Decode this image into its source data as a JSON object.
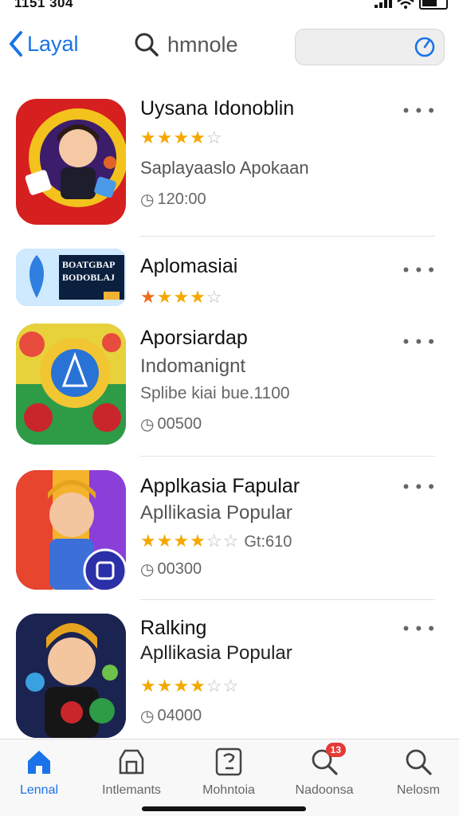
{
  "status": {
    "time": "1151 304"
  },
  "header": {
    "back_label": "Layal",
    "search_label": "hmnole"
  },
  "apps": [
    {
      "title": "Uysana Idonoblin",
      "rating": 4,
      "subtitle": "Saplayaaslo Apokaan",
      "meta": "120:00"
    },
    {
      "title": "Aplomasiai",
      "rating": 4,
      "banner_text": "BOATGBAP BODOBLAJ"
    },
    {
      "title": "Aporsiardap",
      "subtitle": "Indomanignt",
      "subtitle2": "Splibe kiai bue.1100",
      "meta": "00500"
    },
    {
      "title": "Applkasia Fapular",
      "subtitle": "Apllikasia Popular",
      "rating": 4,
      "rating_extra": "Gt:610",
      "meta": "00300"
    },
    {
      "title": "Ralking",
      "subtitle": "Apllikasia Popular",
      "rating": 4,
      "meta": "04000"
    }
  ],
  "tabs": [
    {
      "label": "Lennal",
      "icon": "home-icon",
      "active": true
    },
    {
      "label": "Intlemants",
      "icon": "store-icon"
    },
    {
      "label": "Mohntoia",
      "icon": "document-icon"
    },
    {
      "label": "Nadoonsa",
      "icon": "search-notification-icon",
      "badge": "13"
    },
    {
      "label": "Nelosm",
      "icon": "search-icon"
    }
  ],
  "colors": {
    "accent": "#1a73e8",
    "star": "#f5a800",
    "badge": "#e53935"
  }
}
